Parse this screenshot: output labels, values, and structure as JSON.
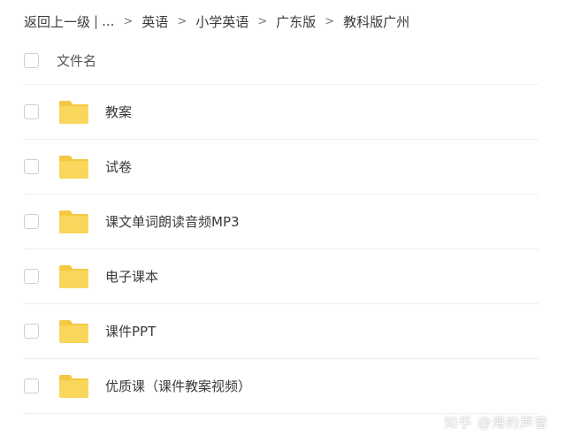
{
  "breadcrumb": {
    "back_label": "返回上一级",
    "pipe": "|",
    "ellipsis": "...",
    "separator": ">",
    "items": [
      "英语",
      "小学英语",
      "广东版",
      "教科版广州"
    ]
  },
  "file_list": {
    "header_label": "文件名",
    "folders": [
      {
        "name": "教案"
      },
      {
        "name": "试卷"
      },
      {
        "name": "课文单词朗读音频MP3"
      },
      {
        "name": "电子课本"
      },
      {
        "name": "课件PPT"
      },
      {
        "name": "优质课（课件教案视频）"
      }
    ]
  },
  "watermark": "知乎 @海的声音",
  "colors": {
    "folder_yellow": "#f9d65c",
    "folder_tab": "#f5c842",
    "checkbox_border": "#cfcfcf",
    "divider": "#eeeeee",
    "text": "#3a3a3a"
  },
  "icons": {
    "folder": "folder-icon",
    "checkbox": "checkbox"
  }
}
